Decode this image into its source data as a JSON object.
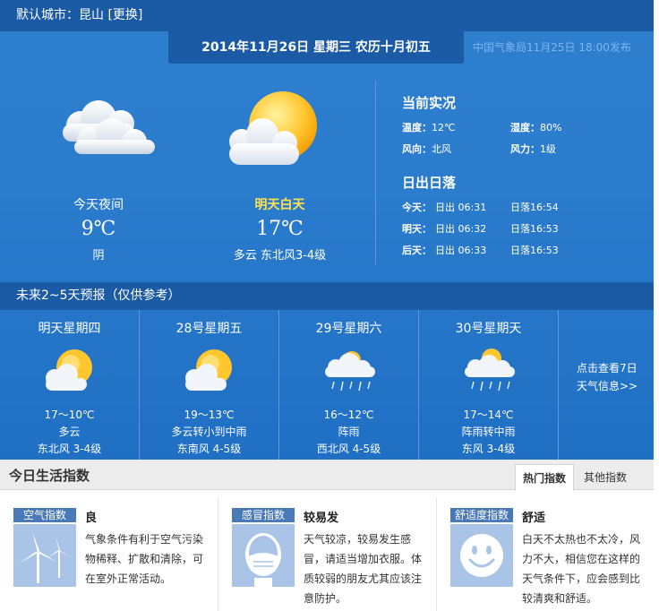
{
  "header": {
    "city_label": "默认城市：",
    "city": "昆山",
    "change": "[更换]",
    "date": "2014年11月26日  星期三  农历十月初五",
    "publish": "中国气象局11月25日 18:00发布"
  },
  "today": {
    "night": {
      "label": "今天夜间",
      "temp": "9℃",
      "desc": "阴",
      "icon": "cloudy-icon"
    },
    "day": {
      "label": "明天白天",
      "temp": "17℃",
      "desc": "多云  东北风3-4级",
      "icon": "partly-cloudy-sun-icon"
    }
  },
  "current": {
    "title": "当前实况",
    "temp_label": "温度：",
    "temp": "12℃",
    "humidity_label": "湿度：",
    "humidity": "80%",
    "wind_dir_label": "风向：",
    "wind_dir": "北风",
    "wind_force_label": "风力：",
    "wind_force": "1级"
  },
  "sun": {
    "title": "日出日落",
    "rows": [
      {
        "day": "今天：",
        "rise": "日出 06:31",
        "set": "日落16:54"
      },
      {
        "day": "明天：",
        "rise": "日出 06:32",
        "set": "日落16:53"
      },
      {
        "day": "后天：",
        "rise": "日出 06:33",
        "set": "日落16:53"
      }
    ]
  },
  "forecast": {
    "title": "未来2~5天预报（仅供参考）",
    "days": [
      {
        "date": "明天星期四",
        "temp": "17～10℃",
        "desc": "多云",
        "wind": "东北风 3-4级",
        "icon": "partly-cloudy-sun-icon"
      },
      {
        "date": "28号星期五",
        "temp": "19～13℃",
        "desc": "多云转小到中雨",
        "wind": "东南风 4-5级",
        "icon": "partly-cloudy-sun-icon"
      },
      {
        "date": "29号星期六",
        "temp": "16～12℃",
        "desc": "阵雨",
        "wind": "西北风 4-5级",
        "icon": "shower-icon"
      },
      {
        "date": "30号星期天",
        "temp": "17～14℃",
        "desc": "阵雨转中雨",
        "wind": "东风 3-4级",
        "icon": "sun-shower-icon"
      }
    ],
    "more_line1": "点击查看7日",
    "more_line2": "天气信息>>"
  },
  "life": {
    "title": "今日生活指数",
    "tabs": [
      "热门指数",
      "其他指数"
    ],
    "cards": [
      {
        "badge": "空气指数",
        "value": "良",
        "desc": "气象条件有利于空气污染物稀释、扩散和清除，可在室外正常活动。",
        "icon": "wind-turbine-icon"
      },
      {
        "badge": "感冒指数",
        "value": "较易发",
        "desc": "天气较凉，较易发生感冒，请适当增加衣服。体质较弱的朋友尤其应该注意防护。",
        "icon": "face-mask-icon"
      },
      {
        "badge": "舒适度指数",
        "value": "舒适",
        "desc": "白天不太热也不太冷，风力不大，相信您在这样的天气条件下，应会感到比较清爽和舒适。",
        "icon": "smiley-icon"
      }
    ]
  },
  "colors": {
    "bar": "#1b5aa5",
    "panel": "#2b7ccd",
    "highlight": "#ffe34d",
    "badge": "#4a79b8"
  }
}
